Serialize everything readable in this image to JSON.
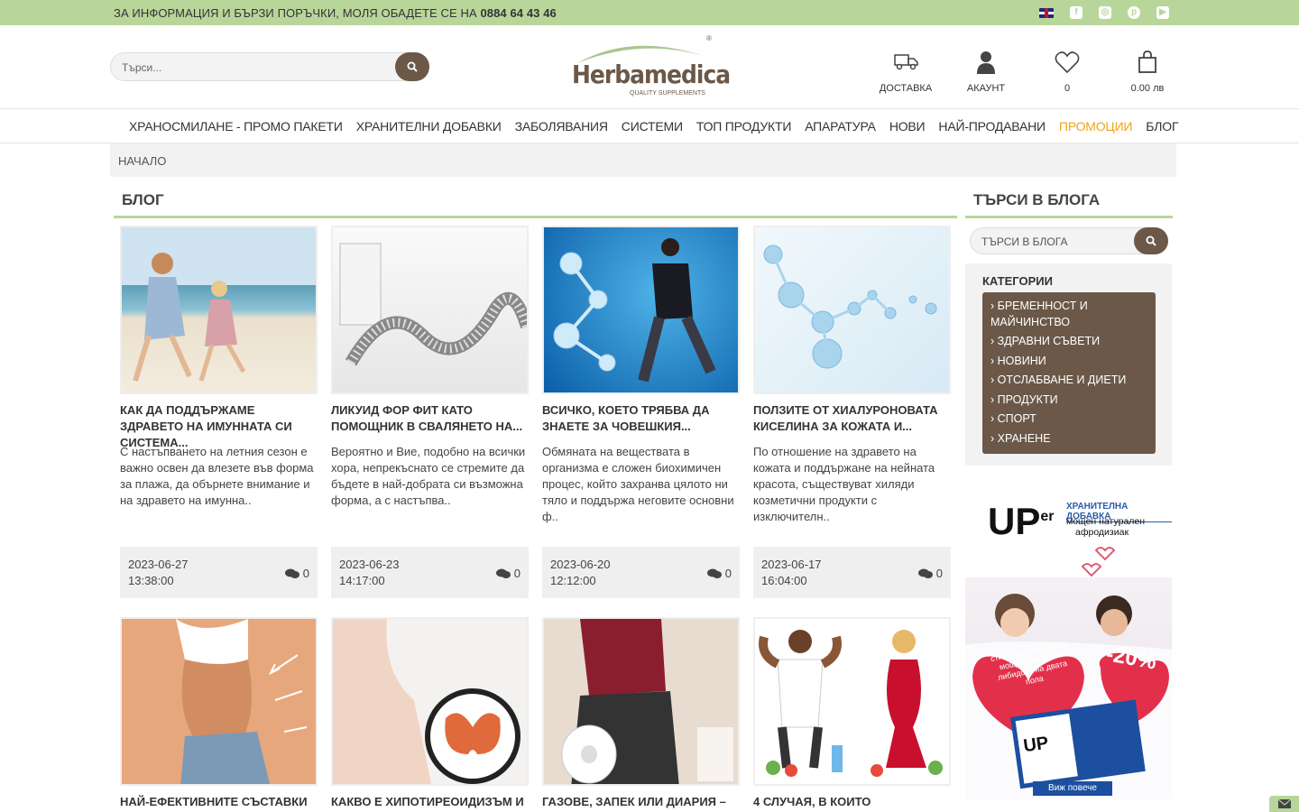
{
  "topbar": {
    "info": "ЗА ИНФОРМАЦИЯ И БЪРЗИ ПОРЪЧКИ, МОЛЯ ОБАДЕТЕ СЕ НА ",
    "phone": "0884 64 43 46"
  },
  "header": {
    "search_placeholder": "Търси...",
    "logo_name": "Herbamedica",
    "logo_sub": "QUALITY SUPPLEMENTS",
    "logo_reg": "®",
    "delivery": "ДОСТАВКА",
    "account": "АКАУНТ",
    "wishlist_count": "0",
    "cart_total": "0.00 лв"
  },
  "nav": {
    "items": [
      "ХРАНОСМИЛАНЕ - ПРОМО ПАКЕТИ",
      "ХРАНИТЕЛНИ ДОБАВКИ",
      "ЗАБОЛЯВАНИЯ",
      "СИСТЕМИ",
      "ТОП ПРОДУКТИ",
      "АПАРАТУРА",
      "НОВИ",
      "НАЙ-ПРОДАВАНИ",
      "ПРОМОЦИИ",
      "БЛОГ"
    ]
  },
  "breadcrumb": "НАЧАЛО",
  "blog_heading": "БЛОГ",
  "blog_search_heading": "ТЪРСИ В БЛОГА",
  "blog_search_placeholder": "ТЪРСИ В БЛОГА",
  "categories_label": "КАТЕГОРИИ",
  "categories": [
    "› БРЕМЕННОСТ И МАЙЧИНСТВО",
    "› ЗДРАВНИ СЪВЕТИ",
    "› НОВИНИ",
    "› ОТСЛАБВАНЕ И ДИЕТИ",
    "› ПРОДУКТИ",
    "› СПОРТ",
    "› ХРАНЕНЕ"
  ],
  "posts": [
    {
      "title": "КАК ДА ПОДДЪРЖАМЕ ЗДРАВЕТО НА ИМУННАТА СИ СИСТЕМА...",
      "excerpt": "С настъпването на летния сезон е важно освен да влезете във форма за плажа, да обърнете внимание и на здравето на имунна..",
      "date": "2023-06-27",
      "time": "13:38:00",
      "comments": "0"
    },
    {
      "title": "ЛИКУИД ФОР ФИТ КАТО ПОМОЩНИК В СВАЛЯНЕТО НА...",
      "excerpt": "Вероятно и Вие, подобно на всички хора, непрекъснато се стремите да бъдете в най-добрата си възможна форма, а с настъпва..",
      "date": "2023-06-23",
      "time": "14:17:00",
      "comments": "0"
    },
    {
      "title": "ВСИЧКО, КОЕТО ТРЯБВА ДА ЗНАЕТЕ ЗА ЧОВЕШКИЯ...",
      "excerpt": "Обмяната на веществата в организма е сложен биохимичен процес, който захранва цялото ни тяло и поддържа неговите основни ф..",
      "date": "2023-06-20",
      "time": "12:12:00",
      "comments": "0"
    },
    {
      "title": "ПОЛЗИТЕ ОТ ХИАЛУРОНОВАТА КИСЕЛИНА ЗА КОЖАТА И...",
      "excerpt": "По отношение на здравето на кожата и поддържане на нейната красота, съществуват хиляди козметични продукти с изключителн..",
      "date": "2023-06-17",
      "time": "16:04:00",
      "comments": "0"
    },
    {
      "title": "НАЙ-ЕФЕКТИВНИТЕ СЪСТАВКИ"
    },
    {
      "title": "КАКВО Е ХИПОТИРЕОИДИЗЪМ И"
    },
    {
      "title": "ГАЗОВЕ, ЗАПЕК ИЛИ ДИАРИЯ –"
    },
    {
      "title": "4 СЛУЧАЯ, В КОИТО"
    }
  ],
  "ad": {
    "brand": "UP",
    "brand_sup": "er",
    "line1": "ХРАНИТЕЛНА ДОБАВКА",
    "line2": "мощен натурален",
    "line3": "афродизиак",
    "heart_text": "стимулира половата мощ и повишава либидото на двата пола",
    "discount": "-20%",
    "cta": "Виж повече"
  }
}
